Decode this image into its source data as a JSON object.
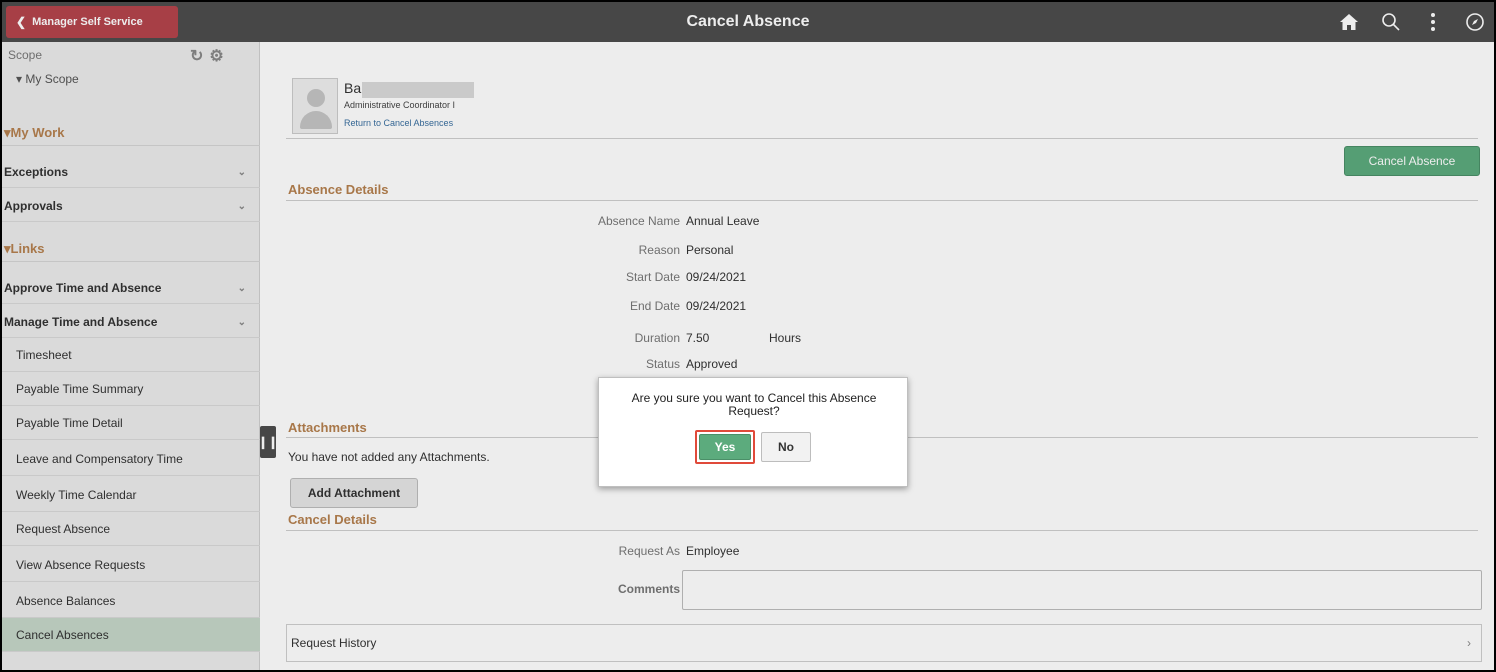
{
  "header": {
    "back_label": "Manager Self Service",
    "title": "Cancel Absence",
    "icons": [
      "home-icon",
      "search-icon",
      "more-vertical-icon",
      "navbar-compass-icon"
    ]
  },
  "sidebar": {
    "scope_label": "Scope",
    "my_scope": "My Scope",
    "my_work_heading": "My Work",
    "exceptions": "Exceptions",
    "approvals": "Approvals",
    "links_heading": "Links",
    "approve_time": "Approve Time and Absence",
    "manage_time": "Manage Time and Absence",
    "items": [
      "Timesheet",
      "Payable Time Summary",
      "Payable Time Detail",
      "Leave and Compensatory Time",
      "Weekly Time Calendar",
      "Request Absence",
      "View Absence Requests",
      "Absence Balances",
      "Cancel Absences"
    ]
  },
  "employee": {
    "name": "Ba",
    "title": "Administrative Coordinator I",
    "return_link": "Return to Cancel Absences"
  },
  "actions": {
    "cancel_absence": "Cancel Absence",
    "add_attachment": "Add Attachment"
  },
  "absence_details": {
    "heading": "Absence Details",
    "absence_name_label": "Absence Name",
    "absence_name": "Annual Leave",
    "reason_label": "Reason",
    "reason": "Personal",
    "start_label": "Start Date",
    "start": "09/24/2021",
    "end_label": "End Date",
    "end": "09/24/2021",
    "duration_label": "Duration",
    "duration": "7.50",
    "duration_unit": "Hours",
    "status_label": "Status",
    "status": "Approved"
  },
  "attachments": {
    "heading": "Attachments",
    "empty_msg": "You have not added any Attachments."
  },
  "cancel_details": {
    "heading": "Cancel Details",
    "request_as_label": "Request As",
    "request_as": "Employee",
    "comments_label": "Comments",
    "comments_value": ""
  },
  "request_history": "Request History",
  "dialog": {
    "message": "Are you sure you want to Cancel this Absence Request?",
    "yes": "Yes",
    "no": "No"
  },
  "colors": {
    "header_bg": "#4d4d4d",
    "back_button": "#b4444c",
    "accent_green": "#5cab7d",
    "section_heading": "#b5814f",
    "active_nav": "#c5d7c9",
    "highlight_border": "#e04a3a"
  }
}
